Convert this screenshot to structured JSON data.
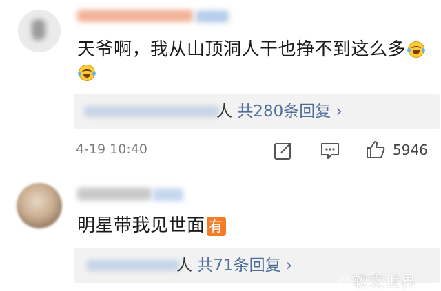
{
  "comments": [
    {
      "text": "天爷啊，我从山顶洞人干也挣不到这么多",
      "emoji_icon": "laughing-crying-emoji-icon",
      "time": "4-19 10:40",
      "reply_person_suffix": "人",
      "reply_count_label": "共280条回复 ›",
      "likes": "5946",
      "actions": [
        "share-icon",
        "comment-icon",
        "like-icon"
      ]
    },
    {
      "text": "明星带我见世面",
      "badge": "有",
      "reply_person_suffix": "人",
      "reply_count_label": "共71条回复 ›"
    }
  ],
  "watermark": "软文世界",
  "colors": {
    "link": "#4e6e9a",
    "badge": "#f37c2a",
    "reply_bg": "#f2f2f2"
  }
}
